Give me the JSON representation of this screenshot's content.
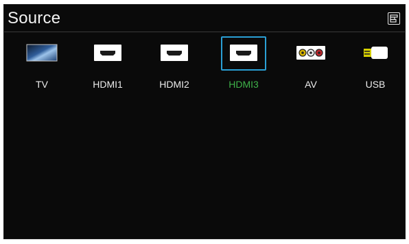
{
  "header": {
    "title": "Source",
    "tools_icon": "tools-icon"
  },
  "sources": [
    {
      "id": "tv",
      "label": "TV",
      "icon": "tv-icon",
      "selected": false
    },
    {
      "id": "hdmi1",
      "label": "HDMI1",
      "icon": "hdmi-port-icon",
      "selected": false
    },
    {
      "id": "hdmi2",
      "label": "HDMI2",
      "icon": "hdmi-port-icon",
      "selected": false
    },
    {
      "id": "hdmi3",
      "label": "HDMI3",
      "icon": "hdmi-port-icon",
      "selected": true
    },
    {
      "id": "av",
      "label": "AV",
      "icon": "av-rca-icon",
      "selected": false
    },
    {
      "id": "usb",
      "label": "USB",
      "icon": "usb-icon",
      "selected": false
    }
  ],
  "colors": {
    "background": "#0a0a0a",
    "text": "#ececec",
    "selected_text": "#3fb34a",
    "focus_ring": "#2aa0d6"
  }
}
